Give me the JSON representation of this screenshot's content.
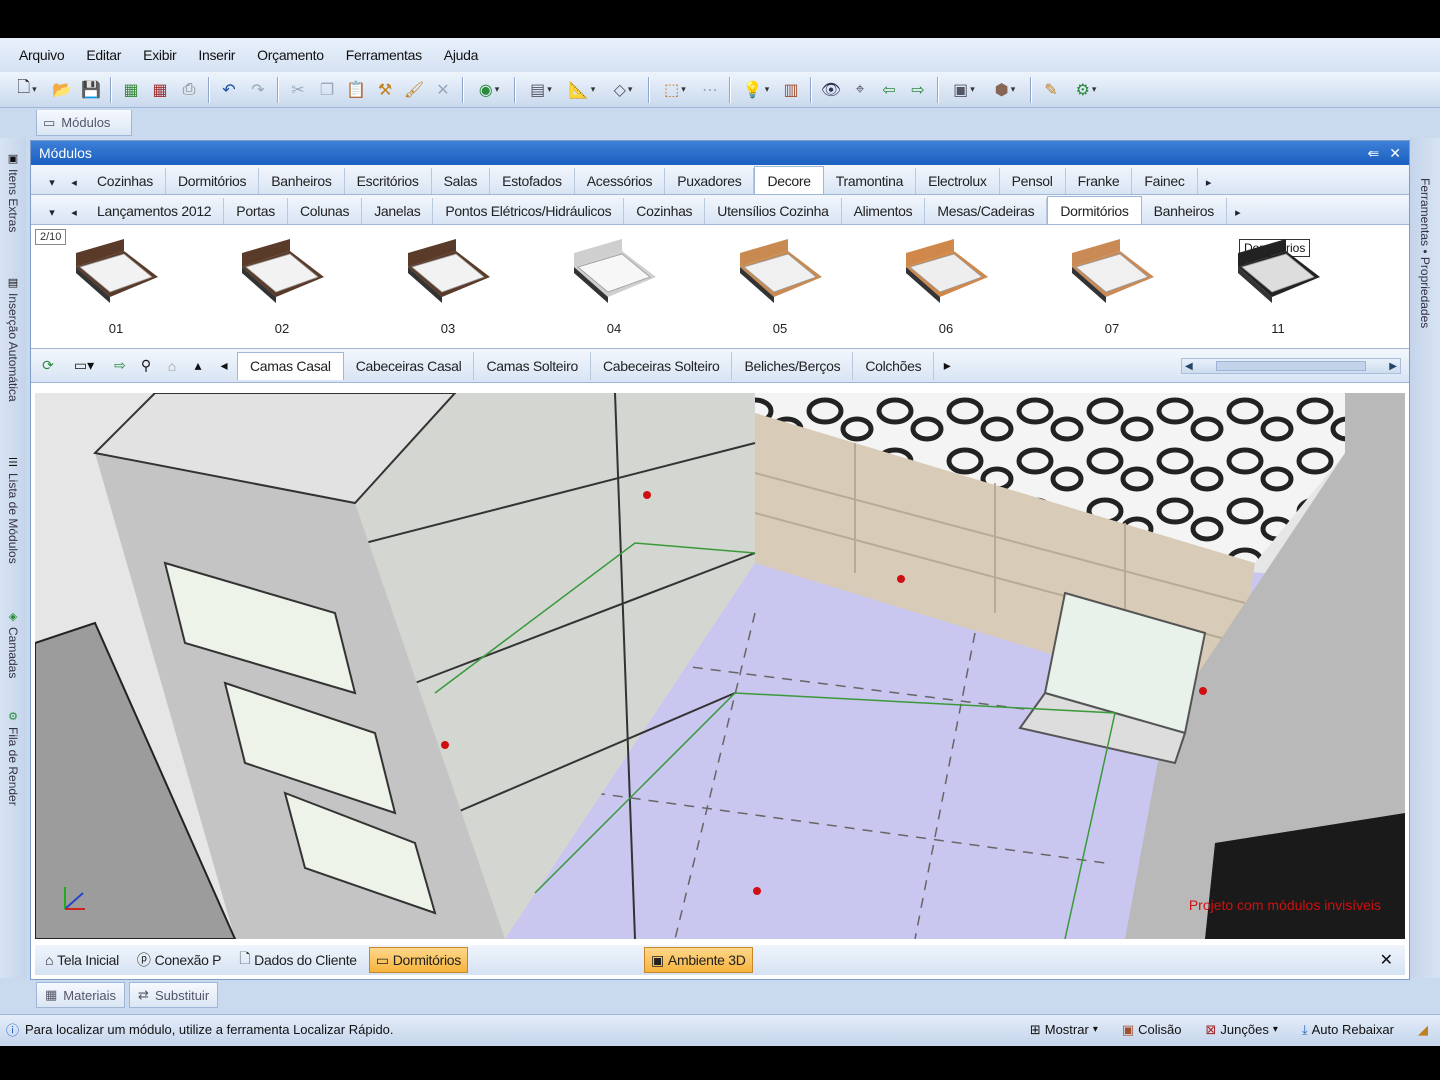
{
  "menu": [
    "Arquivo",
    "Editar",
    "Exibir",
    "Inserir",
    "Orçamento",
    "Ferramentas",
    "Ajuda"
  ],
  "top_doc_tab": "Módulos",
  "left_rail": [
    "Itens Extras",
    "Inserção Automática",
    "Lista de Módulos",
    "Camadas",
    "Fila de Render"
  ],
  "right_rail": "Ferramentas • Propriedades",
  "panel": {
    "title": "Módulos",
    "brand_tabs": [
      "Cozinhas",
      "Dormitórios",
      "Banheiros",
      "Escritórios",
      "Salas",
      "Estofados",
      "Acessórios",
      "Puxadores",
      "Decore",
      "Tramontina",
      "Electrolux",
      "Pensol",
      "Franke",
      "Fainec"
    ],
    "brand_active": "Decore",
    "category_tabs": [
      "Lançamentos 2012",
      "Portas",
      "Colunas",
      "Janelas",
      "Pontos Elétricos/Hidráulicos",
      "Cozinhas",
      "Utensílios Cozinha",
      "Alimentos",
      "Mesas/Cadeiras",
      "Dormitórios",
      "Banheiros"
    ],
    "category_active": "Dormitórios",
    "counter": "2/10",
    "tooltip": "Dormitórios",
    "items": [
      "01",
      "02",
      "03",
      "04",
      "05",
      "06",
      "07",
      "11"
    ],
    "sub_tabs": [
      "Camas Casal",
      "Cabeceiras Casal",
      "Camas Solteiro",
      "Cabeceiras Solteiro",
      "Beliches/Berços",
      "Colchões"
    ],
    "sub_active": "Camas Casal"
  },
  "viewport_note": "Projeto com módulos invisíveis",
  "windows": [
    "Tela Inicial",
    "Conexão P",
    "Dados do Cliente",
    "Dormitórios",
    "Ambiente 3D"
  ],
  "windows_highlighted": [
    "Dormitórios",
    "Ambiente 3D"
  ],
  "bottom_tabs": [
    "Materiais",
    "Substituir"
  ],
  "status": {
    "message": "Para localizar um módulo, utilize a ferramenta Localizar Rápido.",
    "mostrar": "Mostrar",
    "colisao": "Colisão",
    "juncoes": "Junções",
    "auto_rebaixar": "Auto Rebaixar"
  },
  "colors": {
    "accent": "#1b5fc0",
    "highlight": "#f5b33c",
    "floor": "#c9c6ef",
    "marker": "#d01010"
  }
}
